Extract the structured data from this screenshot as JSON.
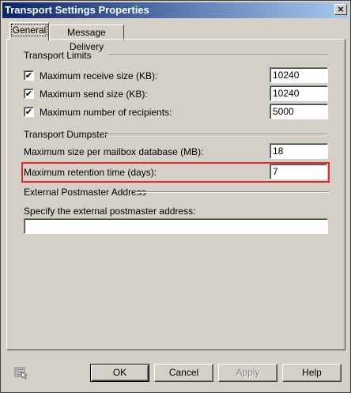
{
  "window": {
    "title": "Transport Settings Properties",
    "close_glyph": "×"
  },
  "tabs": [
    {
      "label": "General",
      "active": true
    },
    {
      "label": "Message Delivery",
      "active": false
    }
  ],
  "transport_limits": {
    "heading": "Transport Limits",
    "rows": [
      {
        "label": "Maximum receive size (KB):",
        "checked": true,
        "value": "10240"
      },
      {
        "label": "Maximum send size (KB):",
        "checked": true,
        "value": "10240"
      },
      {
        "label": "Maximum number of recipients:",
        "checked": true,
        "value": "5000"
      }
    ]
  },
  "transport_dumpster": {
    "heading": "Transport Dumpster",
    "mailbox_size_label": "Maximum size per mailbox database (MB):",
    "mailbox_size_value": "18",
    "retention_label": "Maximum retention time (days):",
    "retention_value": "7"
  },
  "postmaster": {
    "heading": "External Postmaster Address",
    "label": "Specify the external postmaster address:",
    "value": ""
  },
  "check_glyph": "✔",
  "buttons": {
    "ok": "OK",
    "cancel": "Cancel",
    "apply": "Apply",
    "help": "Help"
  },
  "colors": {
    "highlight": "#e8262c",
    "title_start": "#0a246a",
    "title_end": "#a6caf0"
  }
}
